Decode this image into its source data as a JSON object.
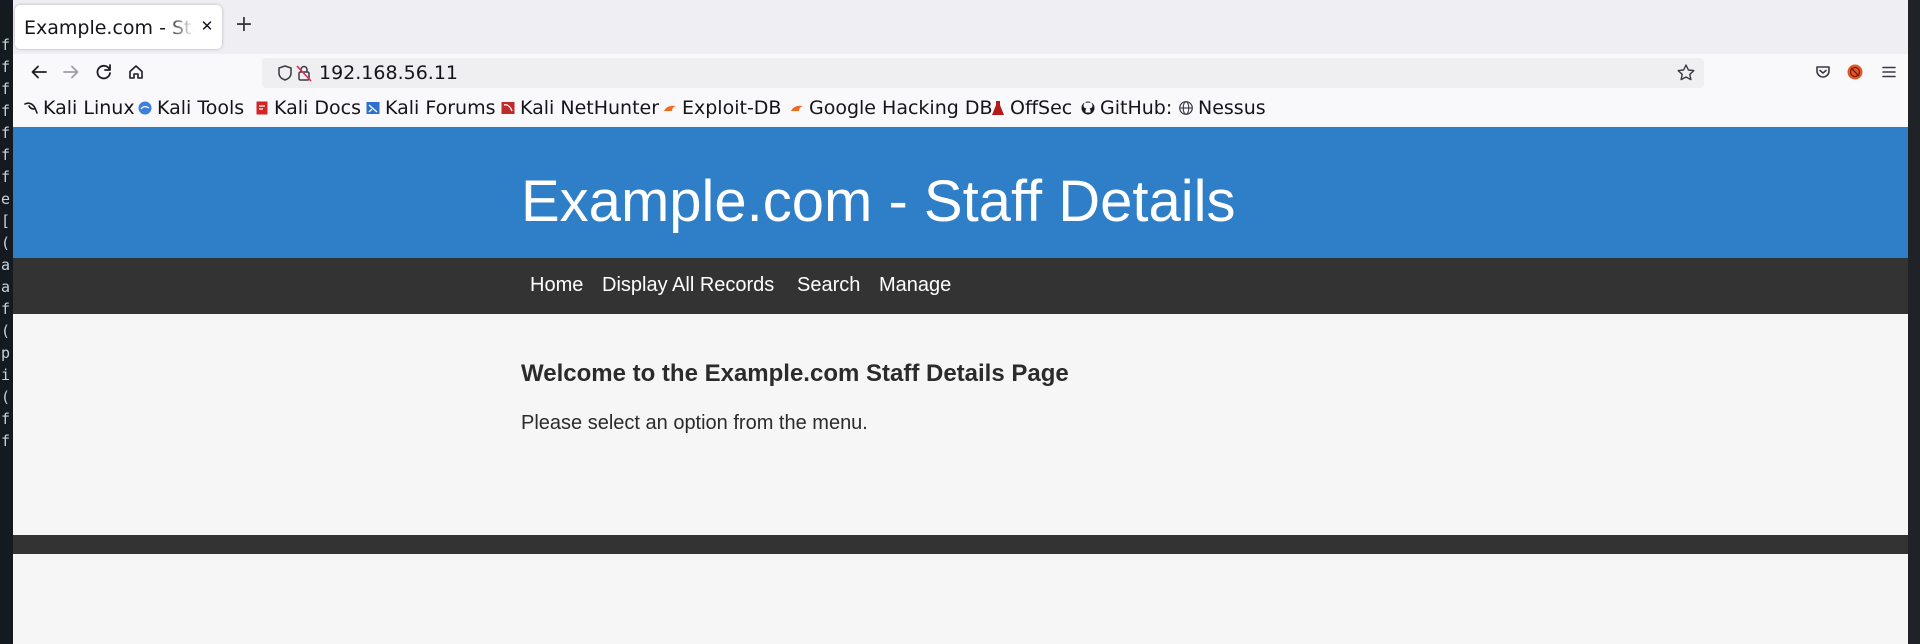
{
  "browser": {
    "tab": {
      "title": "Example.com - Staff Details"
    },
    "url": "192.168.56.11",
    "bookmarks": [
      {
        "label": "Kali Linux",
        "icon": "kali-dragon-icon"
      },
      {
        "label": "Kali Tools",
        "icon": "kali-tools-icon"
      },
      {
        "label": "Kali Docs",
        "icon": "kali-docs-icon"
      },
      {
        "label": "Kali Forums",
        "icon": "kali-forums-icon"
      },
      {
        "label": "Kali NetHunter",
        "icon": "kali-nethunter-icon"
      },
      {
        "label": "Exploit-DB",
        "icon": "exploit-db-icon"
      },
      {
        "label": "Google Hacking DB",
        "icon": "ghdb-icon"
      },
      {
        "label": "OffSec",
        "icon": "offsec-icon"
      },
      {
        "label": "GitHub:",
        "icon": "github-icon"
      },
      {
        "label": "Nessus",
        "icon": "globe-icon"
      }
    ]
  },
  "site": {
    "title": "Example.com - Staff Details",
    "menu": [
      "Home",
      "Display All Records",
      "Search",
      "Manage"
    ],
    "welcome_heading": "Welcome to the Example.com Staff Details Page",
    "welcome_text": "Please select an option from the menu."
  },
  "terminal_chars": [
    "f",
    "f",
    "f",
    "f",
    "f",
    "f",
    "f",
    "e",
    "[",
    "(",
    "a",
    "a",
    "f",
    "(",
    "p",
    "i",
    "(",
    "f",
    "f"
  ],
  "colors": {
    "header_blue": "#2e7ec8",
    "nav_dark": "#333333",
    "page_bg": "#f6f6f6"
  }
}
